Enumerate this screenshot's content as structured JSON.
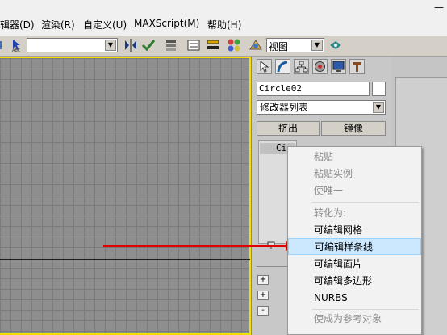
{
  "window": {
    "minimize_glyph": "—"
  },
  "menubar": {
    "items": [
      "辑器(D)",
      "渲染(R)",
      "自定义(U)",
      "MAXScript(M)",
      "帮助(H)"
    ]
  },
  "toolbar": {
    "viewport_select": {
      "value": "视图"
    },
    "selection_set": {
      "value": ""
    }
  },
  "command_panel": {
    "object_name": "Circle02",
    "modifier_list": "修改器列表",
    "extrude_button": "挤出",
    "mirror_button": "镜像",
    "stack_item": "Cir",
    "rollout_toggles": [
      "+",
      "+",
      "-"
    ]
  },
  "context_menu": {
    "items": [
      {
        "label": "粘贴",
        "enabled": false
      },
      {
        "label": "粘贴实例",
        "enabled": false
      },
      {
        "label": "使唯一",
        "enabled": false
      },
      {
        "label": "转化为:",
        "enabled": false
      },
      {
        "label": "可编辑网格",
        "enabled": true
      },
      {
        "label": "可编辑样条线",
        "enabled": true,
        "highlighted": true
      },
      {
        "label": "可编辑面片",
        "enabled": true
      },
      {
        "label": "可编辑多边形",
        "enabled": true
      },
      {
        "label": "NURBS",
        "enabled": true
      },
      {
        "label": "使成为参考对象",
        "enabled": false
      }
    ]
  },
  "colors": {
    "viewport_border": "#f0e000",
    "arrow": "#e00000",
    "highlight": "#cce8ff"
  }
}
